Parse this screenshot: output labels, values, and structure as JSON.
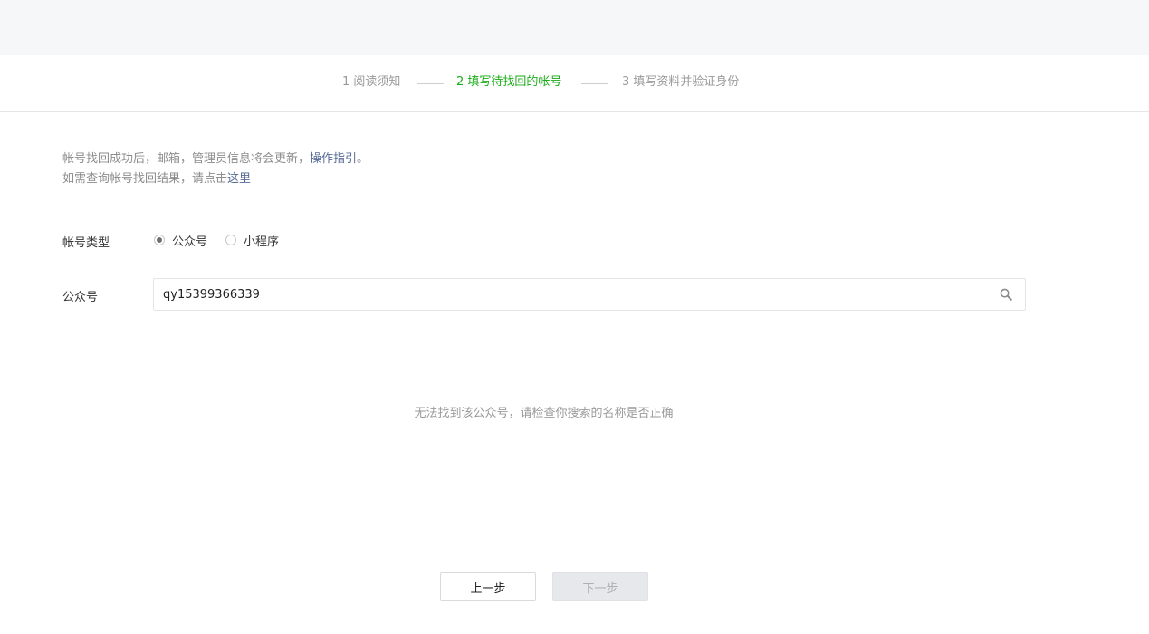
{
  "steps": [
    {
      "label": "1 阅读须知",
      "state": "done"
    },
    {
      "label": "2 填写待找回的帐号",
      "state": "active"
    },
    {
      "label": "3 填写资料并验证身份",
      "state": "pending"
    }
  ],
  "notice": {
    "line1_text": "帐号找回成功后，邮箱，管理员信息将会更新，",
    "line1_link": "操作指引",
    "line1_end": "。",
    "line2_text": "如需查询帐号找回结果，请点击",
    "line2_link": "这里"
  },
  "account_type": {
    "label": "帐号类型",
    "options": [
      {
        "label": "公众号",
        "selected": true
      },
      {
        "label": "小程序",
        "selected": false
      }
    ]
  },
  "search": {
    "label": "公众号",
    "value": "qy15399366339",
    "icon": "search-icon"
  },
  "empty_message": "无法找到该公众号，请检查你搜索的名称是否正确",
  "buttons": {
    "prev": "上一步",
    "next": "下一步"
  },
  "colors": {
    "accent": "#1aad19",
    "link": "#576b95"
  }
}
